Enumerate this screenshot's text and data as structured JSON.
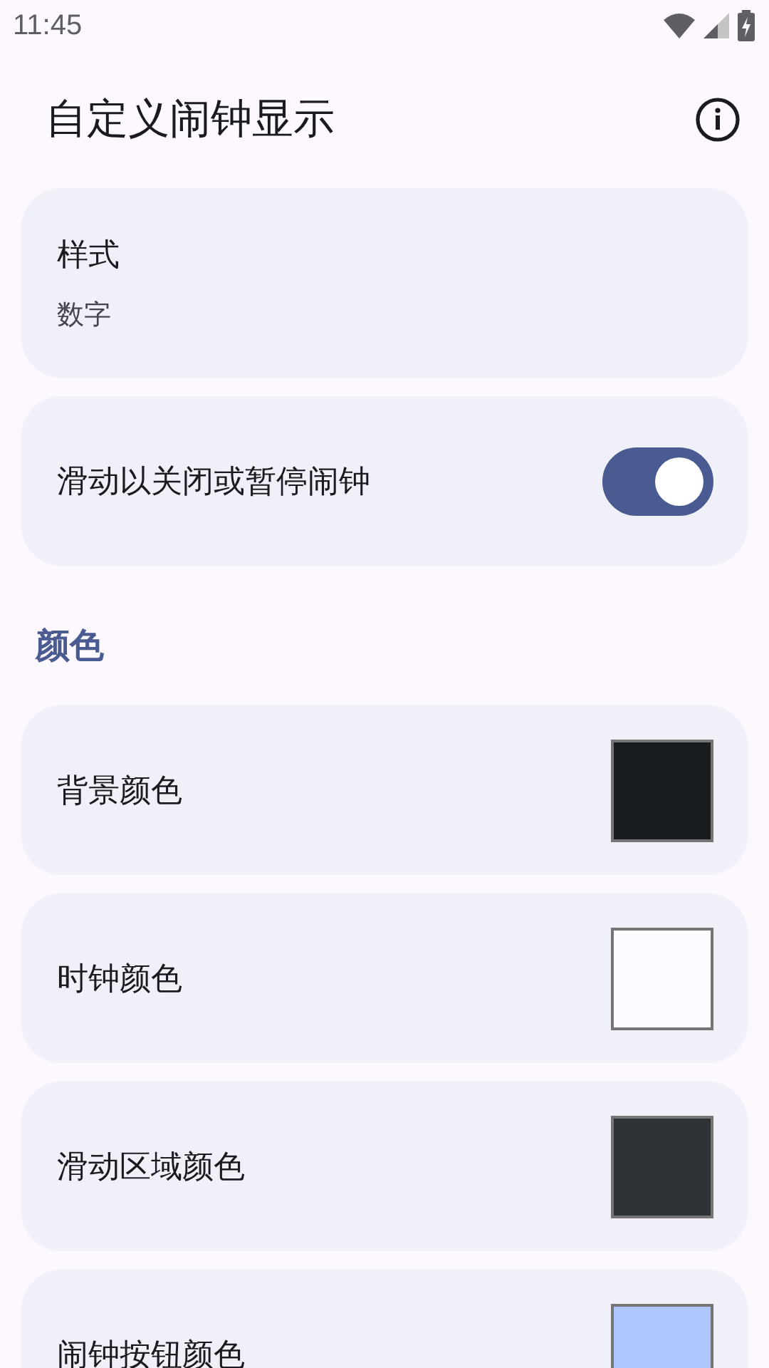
{
  "status_bar": {
    "time": "11:45"
  },
  "app_bar": {
    "title": "自定义闹钟显示"
  },
  "settings": [
    {
      "kind": "value",
      "label": "样式",
      "value": "数字"
    },
    {
      "kind": "switch",
      "label": "滑动以关闭或暂停闹钟",
      "on": true
    }
  ],
  "sections": [
    {
      "title": "颜色",
      "items": [
        {
          "label": "背景颜色",
          "color": "#1a1d20"
        },
        {
          "label": "时钟颜色",
          "color": "#fdfbff"
        },
        {
          "label": "滑动区域颜色",
          "color": "#2e3337"
        },
        {
          "label": "闹钟按钮颜色",
          "color": "#aec6fe"
        }
      ]
    }
  ]
}
